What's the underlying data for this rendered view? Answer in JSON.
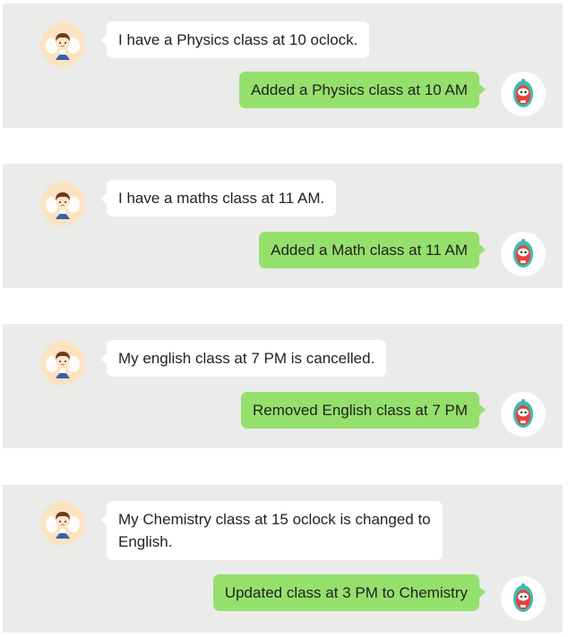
{
  "conversations": [
    {
      "user_message": "I have a Physics class at 10 oclock.",
      "bot_reply": "Added a Physics class at 10 AM"
    },
    {
      "user_message": "I have a maths class at 11 AM.",
      "bot_reply": "Added a Math class at 11 AM"
    },
    {
      "user_message": "My english class at 7 PM is cancelled.",
      "bot_reply": "Removed English class at 7 PM"
    },
    {
      "user_message": "My Chemistry class at 15 oclock is changed to English.",
      "bot_reply": "Updated class at 3 PM to Chemistry"
    }
  ],
  "colors": {
    "panel_bg": "#ebebea",
    "user_bubble": "#ffffff",
    "bot_bubble": "#95e06c"
  },
  "icons": {
    "user_avatar": "boy-angel-avatar-icon",
    "bot_avatar": "robot-avatar-icon"
  }
}
